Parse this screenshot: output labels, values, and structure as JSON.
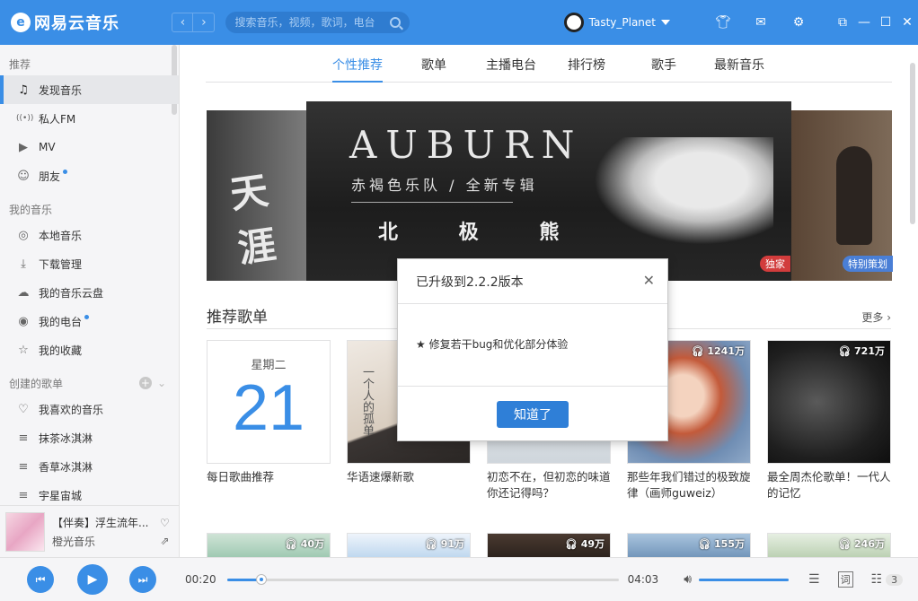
{
  "app": {
    "name": "网易云音乐",
    "logo_letter": "e",
    "back_glyph": "‹",
    "forward_glyph": "›"
  },
  "search": {
    "placeholder": "搜索音乐，视频，歌词，电台"
  },
  "user": {
    "name": "Tasty_Planet"
  },
  "sidebar": {
    "sections": [
      {
        "title": "推荐",
        "items": [
          {
            "label": "发现音乐",
            "icon": "music-note-icon",
            "glyph": "♫",
            "active": true
          },
          {
            "label": "私人FM",
            "icon": "radio-icon",
            "glyph": "((•))"
          },
          {
            "label": "MV",
            "icon": "video-icon",
            "glyph": "▶"
          },
          {
            "label": "朋友",
            "icon": "friends-icon",
            "glyph": "☺",
            "dot": true
          }
        ]
      },
      {
        "title": "我的音乐",
        "items": [
          {
            "label": "本地音乐",
            "icon": "local-music-icon",
            "glyph": "◎"
          },
          {
            "label": "下载管理",
            "icon": "download-icon",
            "glyph": "⤓"
          },
          {
            "label": "我的音乐云盘",
            "icon": "cloud-icon",
            "glyph": "☁"
          },
          {
            "label": "我的电台",
            "icon": "podcast-icon",
            "glyph": "◉",
            "dot": true
          },
          {
            "label": "我的收藏",
            "icon": "favorites-icon",
            "glyph": "☆"
          }
        ]
      },
      {
        "title": "创建的歌单",
        "items": [
          {
            "label": "我喜欢的音乐",
            "icon": "heart-icon",
            "glyph": "♡"
          },
          {
            "label": "抹茶冰淇淋",
            "icon": "playlist-icon",
            "glyph": "≡"
          },
          {
            "label": "香草冰淇淋",
            "icon": "playlist-icon",
            "glyph": "≡"
          },
          {
            "label": "宇星宙城",
            "icon": "playlist-icon",
            "glyph": "≡"
          }
        ]
      }
    ]
  },
  "now_playing": {
    "title": "【伴奏】浮生流年...",
    "artist": "橙光音乐"
  },
  "tabs": [
    {
      "label": "个性推荐",
      "active": true
    },
    {
      "label": "歌单"
    },
    {
      "label": "主播电台"
    },
    {
      "label": "排行榜"
    },
    {
      "label": "歌手"
    },
    {
      "label": "最新音乐"
    }
  ],
  "banner": {
    "left_text": "天涯",
    "title": "AUBURN",
    "subtitle": "赤褐色乐队 / 全新专辑",
    "album": "北 极 熊",
    "tag_exclusive": "独家",
    "tag_special": "特别策划"
  },
  "section": {
    "title": "推荐歌单",
    "more": "更多"
  },
  "cards": [
    {
      "type": "daily",
      "weekday": "星期二",
      "day": "21",
      "title": "每日歌曲推荐"
    },
    {
      "title": "华语速爆新歌",
      "cover_text": "一个人的孤单"
    },
    {
      "title": "初恋不在，但初恋的味道你还记得吗？"
    },
    {
      "title": "那些年我们错过的极致旋律（画师guweiz）",
      "count": "1241万"
    },
    {
      "title": "最全周杰伦歌单！一代人的记忆",
      "count": "721万"
    }
  ],
  "cards_row2": [
    {
      "count": "40万"
    },
    {
      "count": "91万"
    },
    {
      "count": "49万"
    },
    {
      "count": "155万"
    },
    {
      "count": "246万"
    }
  ],
  "dialog": {
    "title": "已升级到2.2.2版本",
    "body": "★ 修复若干bug和优化部分体验",
    "button": "知道了"
  },
  "player": {
    "current_time": "00:20",
    "total_time": "04:03",
    "progress": 0.088,
    "volume": 1.0,
    "queue_count": "3",
    "lyrics_label": "词"
  },
  "colors": {
    "accent": "#3a8ee6",
    "exclusive": "#d23c3c",
    "special": "#4a7fd6"
  }
}
